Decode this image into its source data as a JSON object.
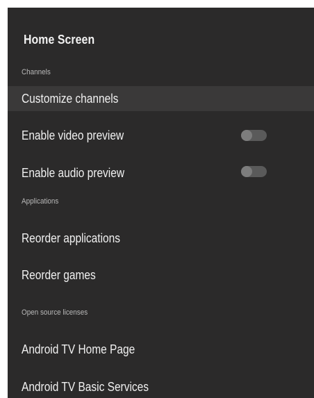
{
  "screen": {
    "title": "Home Screen"
  },
  "sections": {
    "channels": "Channels",
    "applications": "Applications",
    "open_source": "Open source licenses"
  },
  "items": {
    "customize_channels": "Customize channels",
    "enable_video_preview": "Enable video preview",
    "enable_audio_preview": "Enable audio preview",
    "reorder_applications": "Reorder applications",
    "reorder_games": "Reorder games",
    "android_tv_home_page": "Android TV Home Page",
    "android_tv_basic_services": "Android TV Basic Services"
  },
  "toggles": {
    "video_preview_on": false,
    "audio_preview_on": false
  },
  "colors": {
    "panel_bg": "#2b2a2a",
    "focused_row_bg": "#3a3939",
    "toggle_track": "#5a5a5a",
    "toggle_knob": "#7d7d7d"
  }
}
